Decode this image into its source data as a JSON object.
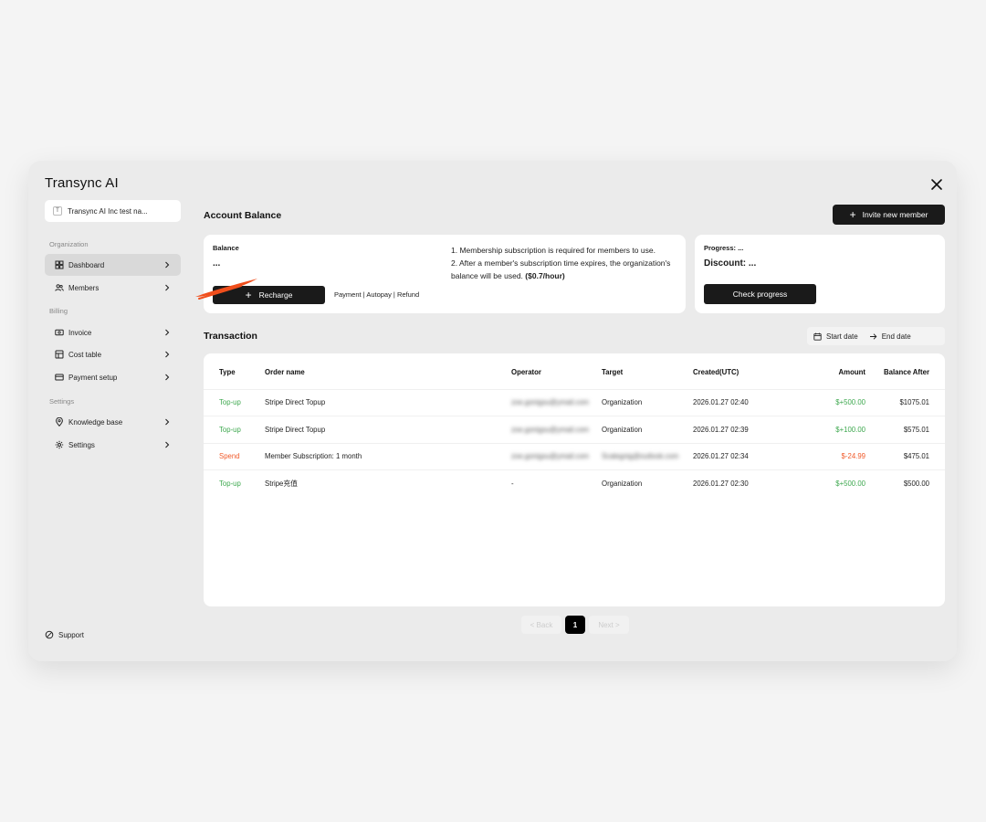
{
  "app": {
    "title": "Transync AI"
  },
  "sidebar": {
    "org_name": "Transync AI Inc test na...",
    "org_badge": "T",
    "sections": {
      "organization": "Organization",
      "billing": "Billing",
      "settings": "Settings"
    },
    "items": {
      "dashboard": "Dashboard",
      "members": "Members",
      "invoice": "Invoice",
      "cost_table": "Cost table",
      "payment_setup": "Payment setup",
      "knowledge_base": "Knowledge base",
      "settings": "Settings"
    },
    "support": "Support"
  },
  "account": {
    "title": "Account Balance",
    "invite_label": "Invite new member",
    "balance_label": "Balance",
    "balance_value": "...",
    "recharge_label": "Recharge",
    "link_payment": "Payment",
    "link_autopay": "Autopay",
    "link_refund": "Refund",
    "note1": "1. Membership subscription is required for members to use.",
    "note2": "2. After a member's subscription time expires, the organization's balance will be used.",
    "note2_rate": "($0.7/hour)",
    "progress_label": "Progress: ...",
    "discount_label": "Discount: ...",
    "check_progress_label": "Check progress"
  },
  "transaction": {
    "title": "Transaction",
    "start_date": "Start date",
    "end_date": "End date",
    "columns": {
      "type": "Type",
      "order": "Order name",
      "operator": "Operator",
      "target": "Target",
      "created": "Created(UTC)",
      "amount": "Amount",
      "after": "Balance After"
    },
    "rows": [
      {
        "type": "Top-up",
        "order": "Stripe Direct Topup",
        "operator": "zoe.gonigsu@ymail.com",
        "target": "Organization",
        "created": "2026.01.27 02:40",
        "amount": "$+500.00",
        "after": "$1075.01"
      },
      {
        "type": "Top-up",
        "order": "Stripe Direct Topup",
        "operator": "zoe.gonigsu@ymail.com",
        "target": "Organization",
        "created": "2026.01.27 02:39",
        "amount": "$+100.00",
        "after": "$575.01"
      },
      {
        "type": "Spend",
        "order": "Member Subscription: 1 month",
        "operator": "zoe.gonigsu@ymail.com",
        "target": "Scalegnig@outlook.com",
        "created": "2026.01.27 02:34",
        "amount": "$-24.99",
        "after": "$475.01"
      },
      {
        "type": "Top-up",
        "order": "Stripe充值",
        "operator": "-",
        "target": "Organization",
        "created": "2026.01.27 02:30",
        "amount": "$+500.00",
        "after": "$500.00"
      }
    ]
  },
  "pagination": {
    "back": "< Back",
    "page": "1",
    "next": "Next >"
  },
  "colors": {
    "positive": "#3ea84f",
    "negative": "#f05a2a",
    "accent_brush": "#f04e1c"
  }
}
